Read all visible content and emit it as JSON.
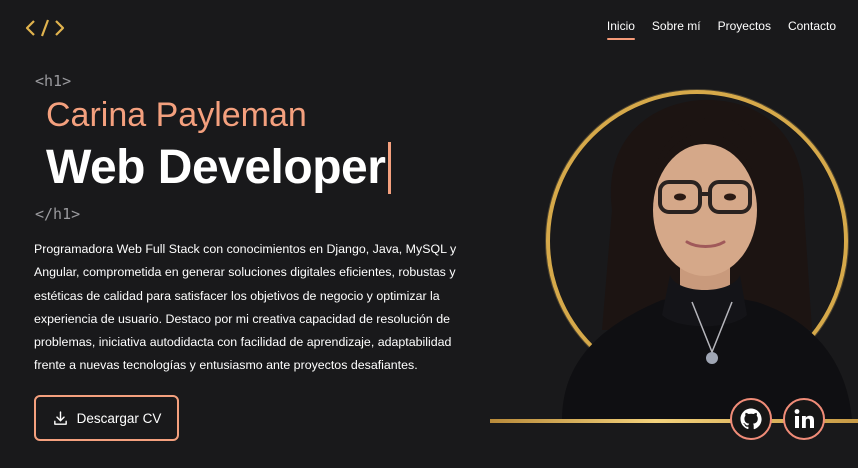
{
  "nav": {
    "items": [
      {
        "label": "Inicio",
        "active": true
      },
      {
        "label": "Sobre mí",
        "active": false
      },
      {
        "label": "Proyectos",
        "active": false
      },
      {
        "label": "Contacto",
        "active": false
      }
    ]
  },
  "hero": {
    "tag_open": "<h1>",
    "name": "Carina Payleman",
    "role": "Web Developer",
    "tag_close": "</h1>",
    "description": "Programadora Web Full Stack con conocimientos en Django, Java, MySQL y Angular, comprometida en generar soluciones digitales eficientes, robustas y estéticas de calidad para satisfacer los objetivos de negocio y optimizar la experiencia de usuario. Destaco por mi creativa capacidad de resolución de problemas, iniciativa autodidacta con facilidad de aprendizaje, adaptabilidad frente a nuevas tecnologías y entusiasmo ante proyectos desafiantes.",
    "download_label": "Descargar CV"
  },
  "social": {
    "icons": [
      "github-icon",
      "linkedin-icon"
    ]
  },
  "colors": {
    "background": "#19191b",
    "accent": "#f4a07e",
    "gold": "#d6a94a",
    "logo": "#e0b34e"
  }
}
